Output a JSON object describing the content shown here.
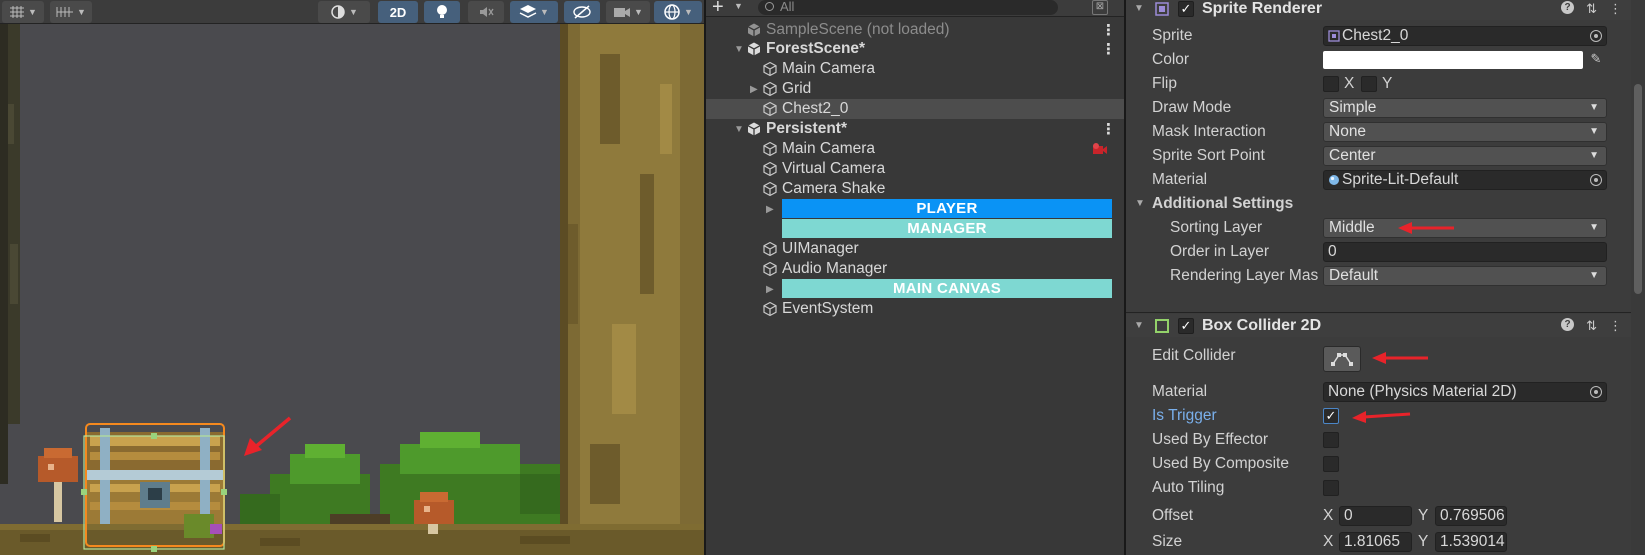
{
  "scene_toolbar": {
    "view_2d_label": "2D",
    "colors": {
      "active_button": "#46607c",
      "background": "#3c3c3c"
    }
  },
  "hierarchy": {
    "search_placeholder": "All",
    "items": [
      {
        "label": "SampleScene (not loaded)",
        "kind": "scene",
        "muted": true
      },
      {
        "label": "ForestScene*",
        "kind": "scene",
        "expanded": true
      },
      {
        "label": "Main Camera",
        "kind": "object"
      },
      {
        "label": "Grid",
        "kind": "object",
        "has_children": true
      },
      {
        "label": "Chest2_0",
        "kind": "object",
        "selected": true
      },
      {
        "label": "Persistent*",
        "kind": "scene",
        "expanded": true
      },
      {
        "label": "Main Camera",
        "kind": "object",
        "badge": "camera-warning-icon"
      },
      {
        "label": "Virtual Camera",
        "kind": "object"
      },
      {
        "label": "Camera Shake",
        "kind": "object"
      },
      {
        "label": "PLAYER",
        "kind": "header-bar",
        "color": "#0a93f5"
      },
      {
        "label": "MANAGER",
        "kind": "header-bar",
        "color": "#7ed8d2"
      },
      {
        "label": "UIManager",
        "kind": "object"
      },
      {
        "label": "Audio Manager",
        "kind": "object"
      },
      {
        "label": "MAIN CANVAS",
        "kind": "header-bar",
        "color": "#7ed8d2"
      },
      {
        "label": "EventSystem",
        "kind": "object"
      }
    ]
  },
  "inspector": {
    "sprite_renderer": {
      "title": "Sprite Renderer",
      "sprite_label": "Sprite",
      "sprite_value": "Chest2_0",
      "color_label": "Color",
      "color_value": "#ffffff",
      "flip_label": "Flip",
      "flip_x": "X",
      "flip_y": "Y",
      "draw_mode_label": "Draw Mode",
      "draw_mode_value": "Simple",
      "mask_label": "Mask Interaction",
      "mask_value": "None",
      "sort_point_label": "Sprite Sort Point",
      "sort_point_value": "Center",
      "material_label": "Material",
      "material_value": "Sprite-Lit-Default",
      "additional_label": "Additional Settings",
      "sorting_layer_label": "Sorting Layer",
      "sorting_layer_value": "Middle",
      "order_label": "Order in Layer",
      "order_value": "0",
      "rendering_layer_label": "Rendering Layer Mas",
      "rendering_layer_value": "Default"
    },
    "box_collider": {
      "title": "Box Collider 2D",
      "edit_label": "Edit Collider",
      "material_label": "Material",
      "material_value": "None (Physics Material 2D)",
      "trigger_label": "Is Trigger",
      "is_trigger": true,
      "effector_label": "Used By Effector",
      "composite_label": "Used By Composite",
      "tiling_label": "Auto Tiling",
      "offset_label": "Offset",
      "offset_x_label": "X",
      "offset_x": "0",
      "offset_y_label": "Y",
      "offset_y": "0.769506",
      "size_label": "Size",
      "size_x_label": "X",
      "size_x": "1.81065",
      "size_y_label": "Y",
      "size_y": "1.539014"
    },
    "colors": {
      "annotation_arrow": "#e8232a",
      "link_label": "#7ab0ec"
    }
  }
}
